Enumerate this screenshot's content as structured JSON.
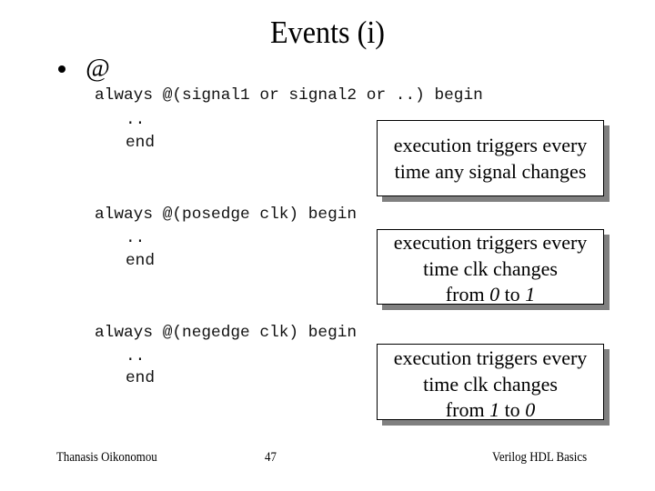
{
  "slide": {
    "title": "Events (i)",
    "bullet": {
      "icon": "bullet-dot",
      "text": "@"
    },
    "blocks": [
      {
        "code_head": "always @(signal1 or signal2 or ..) begin",
        "code_body": "..",
        "code_end": "end",
        "note_lines": [
          "execution triggers every",
          "time any signal changes"
        ]
      },
      {
        "code_head": "always @(posedge clk) begin",
        "code_body": "..",
        "code_end": "end",
        "note_lines": [
          "execution triggers every",
          "time clk changes"
        ],
        "note_from": {
          "prefix": "from ",
          "from_value": "0",
          "middle": " to ",
          "to_value": "1"
        }
      },
      {
        "code_head": "always @(negedge clk) begin",
        "code_body": "..",
        "code_end": "end",
        "note_lines": [
          "execution triggers every",
          "time clk changes"
        ],
        "note_from": {
          "prefix": "from ",
          "from_value": "1",
          "middle": " to ",
          "to_value": "0"
        }
      }
    ],
    "colors": {
      "box_shadow": "#808080",
      "box_border": "#000000",
      "background": "#ffffff"
    }
  },
  "footer": {
    "author": "Thanasis Oikonomou",
    "page_number": "47",
    "course": "Verilog HDL Basics"
  }
}
